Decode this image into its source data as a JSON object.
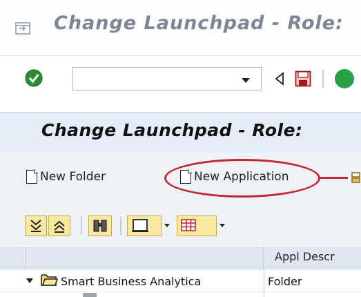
{
  "window": {
    "title": "Change Launchpad - Role:"
  },
  "std_toolbar": {
    "command_field_value": ""
  },
  "screen_title": "Change Launchpad - Role: ",
  "app_toolbar": {
    "new_folder_label": "New Folder",
    "new_application_label": "New Application"
  },
  "annotation": {
    "color": "#c1272d",
    "highlights": "New Application"
  },
  "grid": {
    "columns": [
      "",
      "Appl Descr"
    ],
    "rows": [
      {
        "name": "Smart Business Analytica",
        "type": "Folder",
        "expanded": true
      }
    ]
  },
  "icons": {
    "title": "screen-icon",
    "ok": "enter-check-icon",
    "back": "back-arrow-icon",
    "save": "save-icon",
    "alv": [
      "expand-all-icon",
      "collapse-all-icon",
      "find-icon",
      "print-icon",
      "layout-grid-icon"
    ]
  }
}
